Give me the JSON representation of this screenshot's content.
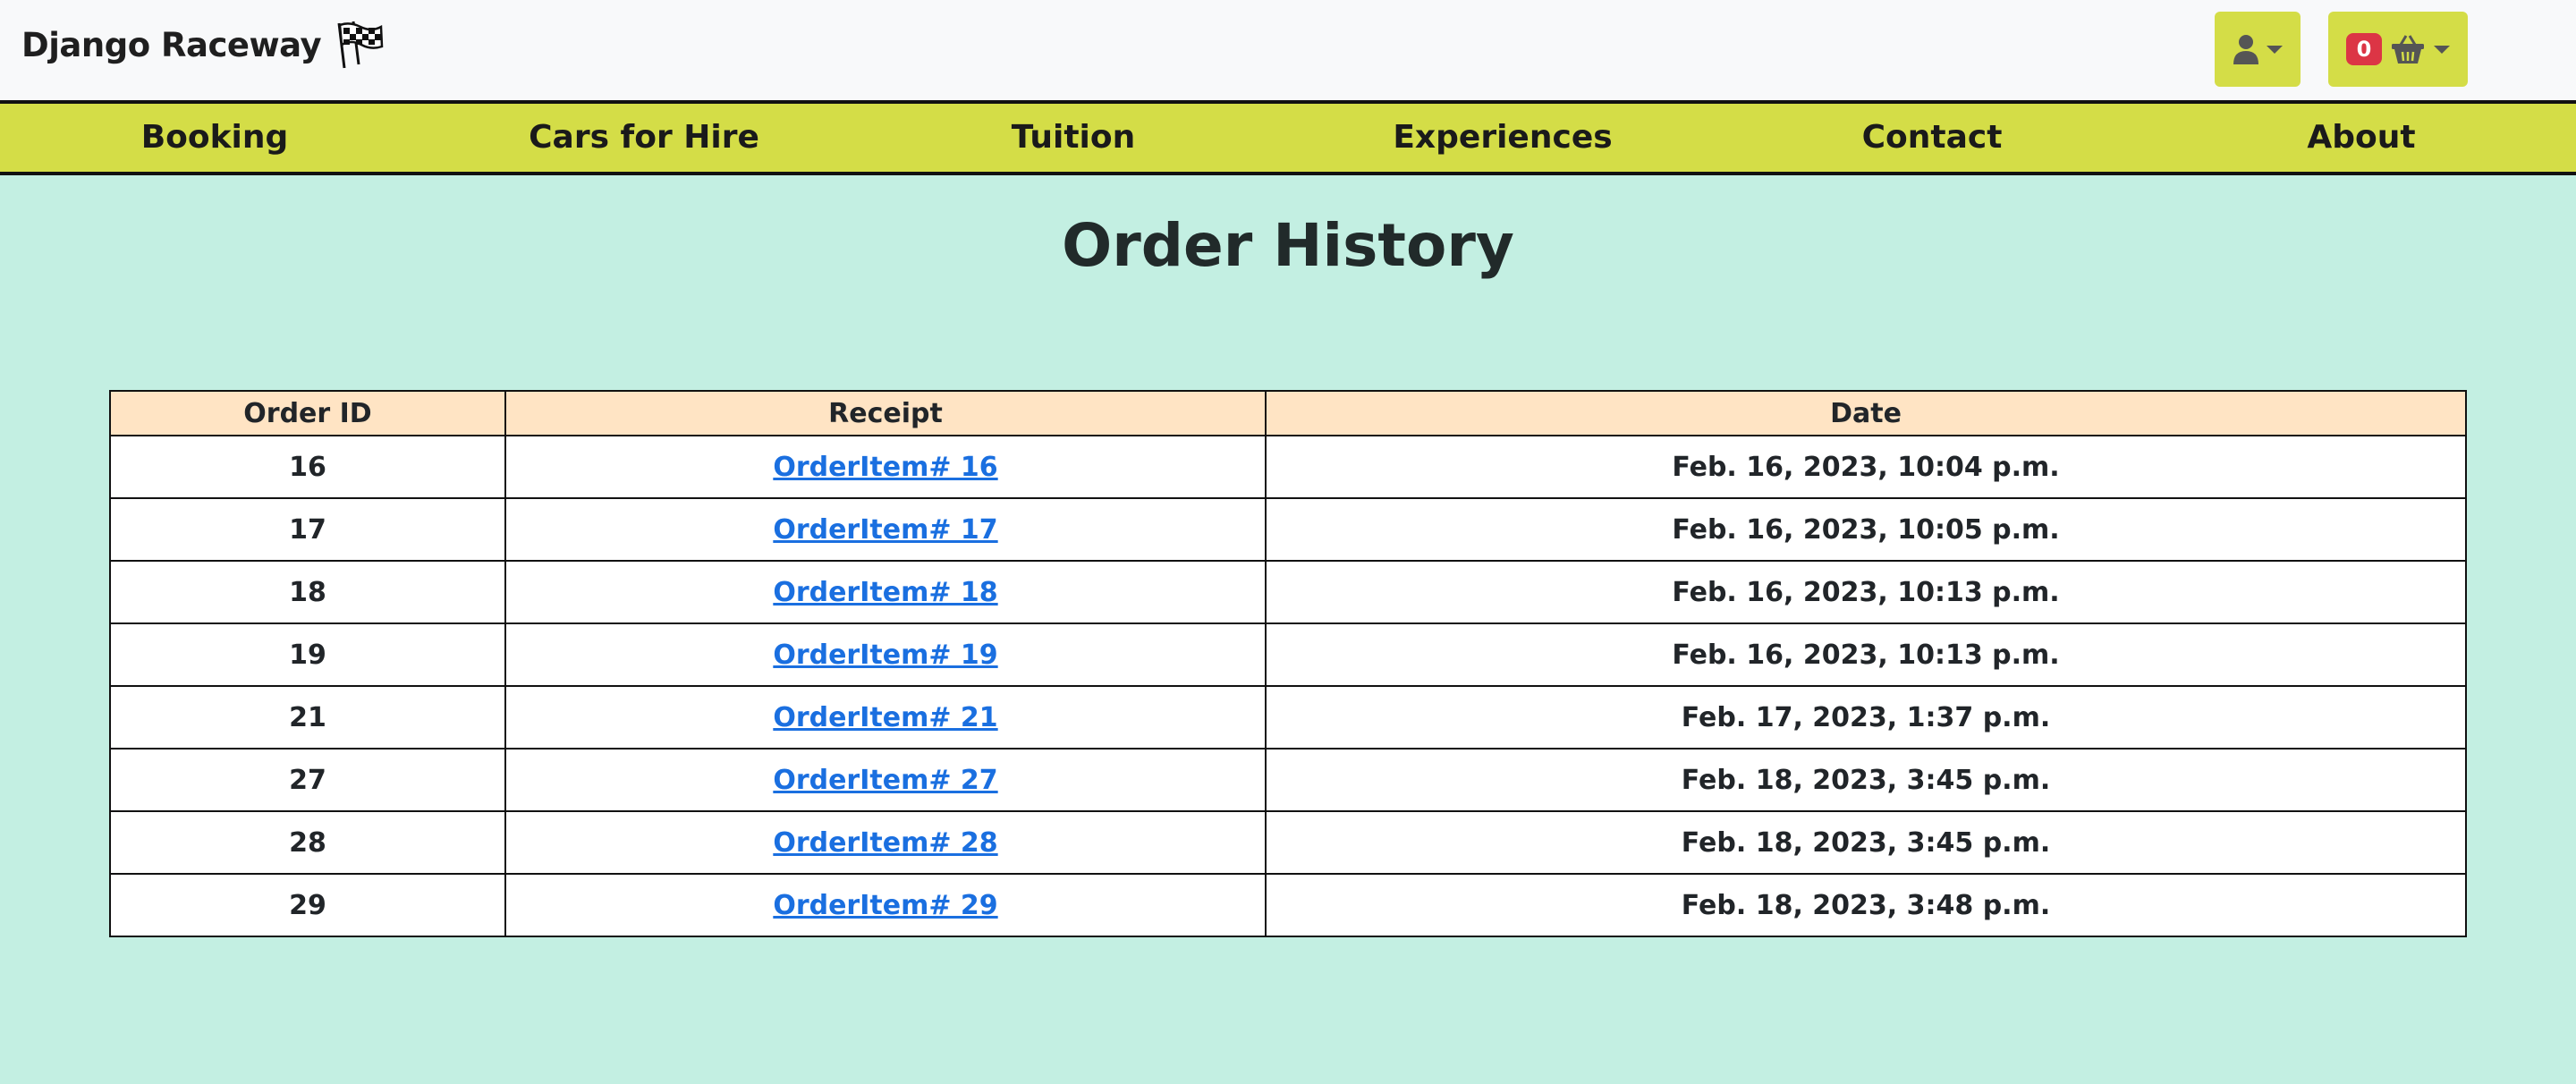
{
  "header": {
    "brand": "Django Raceway",
    "flag_icon": "checkered-flag-icon",
    "user_icon": "user-icon",
    "cart_icon": "basket-icon",
    "cart_count": "0"
  },
  "nav": {
    "items": [
      {
        "label": "Booking"
      },
      {
        "label": "Cars for Hire"
      },
      {
        "label": "Tuition"
      },
      {
        "label": "Experiences"
      },
      {
        "label": "Contact"
      },
      {
        "label": "About"
      }
    ]
  },
  "main": {
    "title": "Order History",
    "table": {
      "headers": [
        "Order ID",
        "Receipt",
        "Date"
      ],
      "rows": [
        {
          "id": "16",
          "receipt": "OrderItem# 16",
          "date": "Feb. 16, 2023, 10:04 p.m."
        },
        {
          "id": "17",
          "receipt": "OrderItem# 17",
          "date": "Feb. 16, 2023, 10:05 p.m."
        },
        {
          "id": "18",
          "receipt": "OrderItem# 18",
          "date": "Feb. 16, 2023, 10:13 p.m."
        },
        {
          "id": "19",
          "receipt": "OrderItem# 19",
          "date": "Feb. 16, 2023, 10:13 p.m."
        },
        {
          "id": "21",
          "receipt": "OrderItem# 21",
          "date": "Feb. 17, 2023, 1:37 p.m."
        },
        {
          "id": "27",
          "receipt": "OrderItem# 27",
          "date": "Feb. 18, 2023, 3:45 p.m."
        },
        {
          "id": "28",
          "receipt": "OrderItem# 28",
          "date": "Feb. 18, 2023, 3:45 p.m."
        },
        {
          "id": "29",
          "receipt": "OrderItem# 29",
          "date": "Feb. 18, 2023, 3:48 p.m."
        }
      ]
    }
  },
  "colors": {
    "page_bg": "#c3efe2",
    "accent": "#d4dd47",
    "header_row": "#ffe4c4",
    "link": "#1a6fe0",
    "badge": "#dc3545"
  }
}
